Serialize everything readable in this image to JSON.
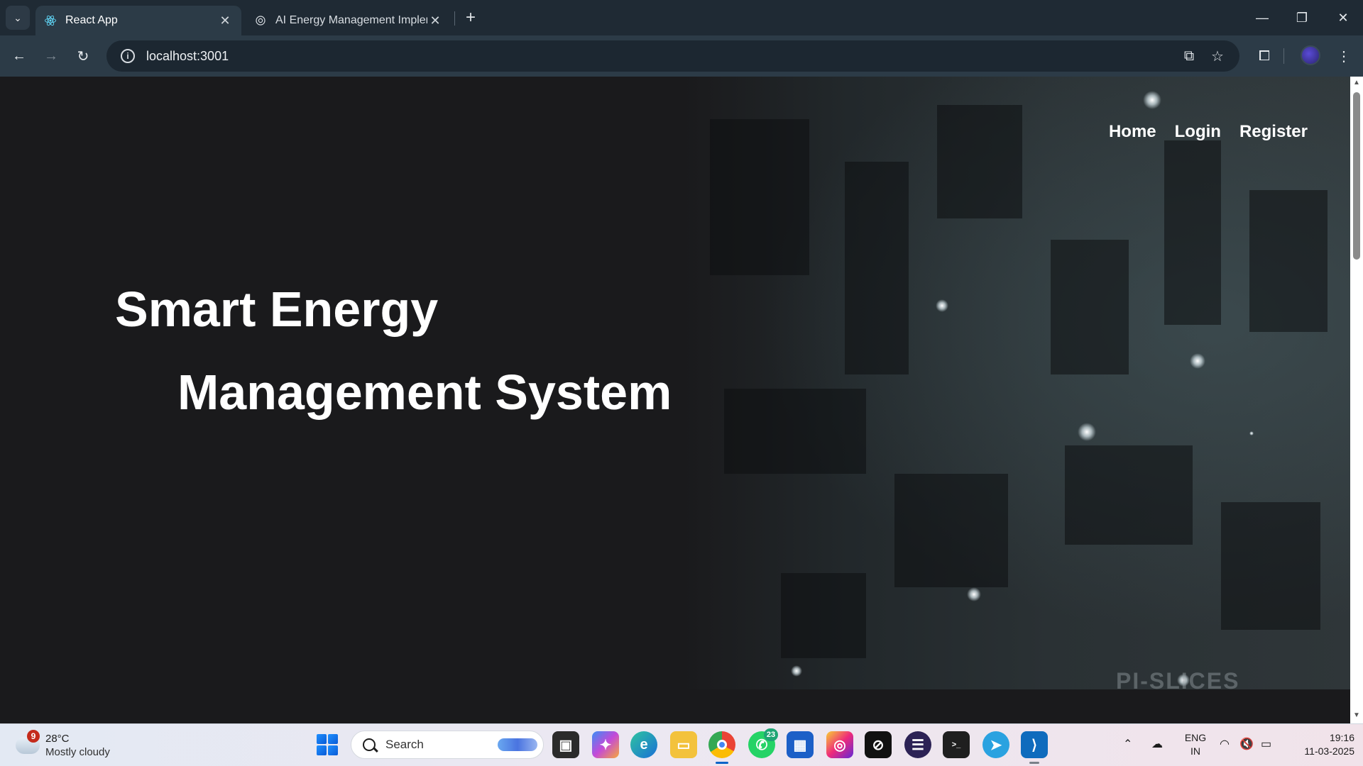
{
  "browser": {
    "tabs": [
      {
        "title": "React App",
        "active": true
      },
      {
        "title": "AI Energy Management Implem",
        "active": false
      }
    ],
    "url": "localhost:3001"
  },
  "page": {
    "nav": {
      "home": "Home",
      "login": "Login",
      "register": "Register"
    },
    "hero": {
      "line1": "Smart Energy",
      "line2": "Management System"
    },
    "watermark": "PI-SLICES"
  },
  "taskbar": {
    "weather": {
      "badge": "9",
      "temperature": "28°C",
      "condition": "Mostly cloudy"
    },
    "search_placeholder": "Search",
    "whatsapp_badge": "23",
    "language": {
      "line1": "ENG",
      "line2": "IN"
    },
    "clock": {
      "time": "19:16",
      "date": "11-03-2025"
    }
  },
  "colors": {
    "page_bg": "#1a1a1c",
    "chrome_tabbar": "#1f2a34",
    "chrome_toolbar": "#2c3b47",
    "hero_text": "#ffffff"
  }
}
